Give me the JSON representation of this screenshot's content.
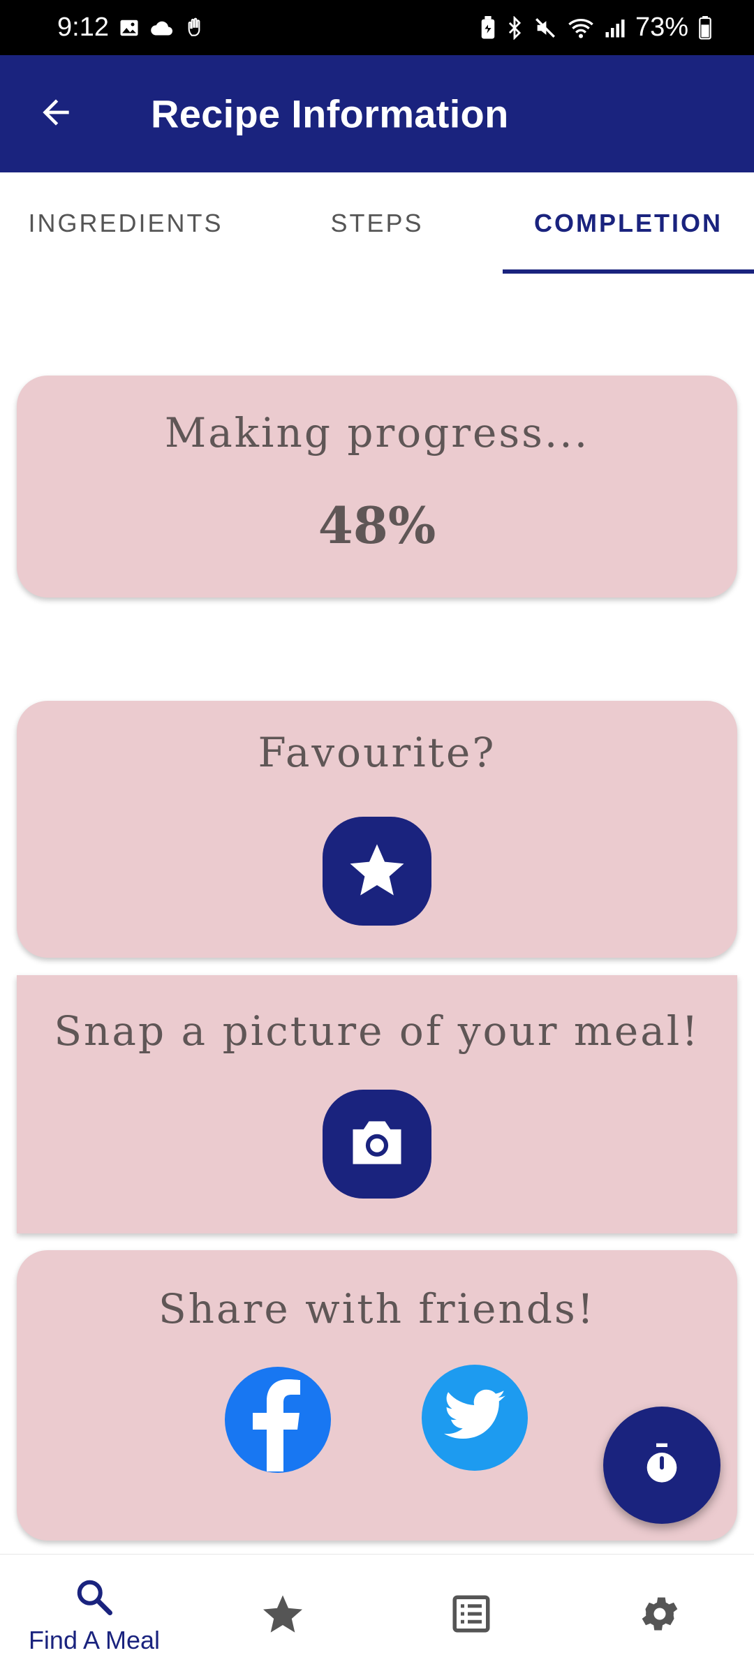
{
  "status_bar": {
    "time": "9:12",
    "battery": "73%",
    "icons_left": [
      "image-icon",
      "cloud-icon",
      "hand-icon"
    ],
    "icons_right": [
      "battery-saver-icon",
      "bluetooth-icon",
      "mute-icon",
      "wifi-icon",
      "signal-icon",
      "battery-icon"
    ]
  },
  "app_bar": {
    "title": "Recipe Information",
    "back_icon": "arrow-back-icon"
  },
  "tabs": [
    {
      "label": "INGREDIENTS",
      "active": false
    },
    {
      "label": "STEPS",
      "active": false
    },
    {
      "label": "COMPLETION",
      "active": true
    }
  ],
  "progress_card": {
    "title": "Making progress...",
    "value": "48%"
  },
  "favourite_card": {
    "title": "Favourite?",
    "icon": "star-icon"
  },
  "photo_card": {
    "title": "Snap a picture of your meal!",
    "icon": "camera-icon"
  },
  "share_card": {
    "title": "Share with friends!",
    "icons": [
      "facebook-icon",
      "twitter-icon"
    ]
  },
  "fab": {
    "icon": "timer-icon"
  },
  "bottom_nav": [
    {
      "label": "Find A Meal",
      "icon": "search-icon",
      "active": true
    },
    {
      "label": "",
      "icon": "star-icon",
      "active": false
    },
    {
      "label": "",
      "icon": "list-icon",
      "active": false
    },
    {
      "label": "",
      "icon": "gear-icon",
      "active": false
    }
  ],
  "colors": {
    "primary": "#1a237e",
    "card_background": "#ebcbcf",
    "card_text": "#5f5656",
    "facebook": "#1877f2",
    "twitter": "#1d9bf0"
  }
}
